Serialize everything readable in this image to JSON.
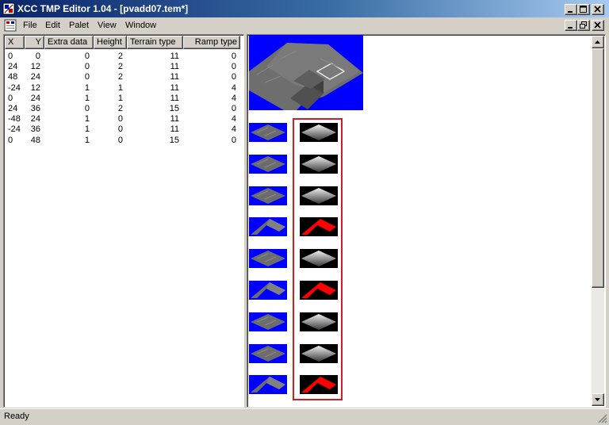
{
  "window": {
    "title": "XCC TMP Editor 1.04 - [pvadd07.tem*]"
  },
  "menu": [
    "File",
    "Edit",
    "Palet",
    "View",
    "Window"
  ],
  "table": {
    "headers": [
      "X",
      "Y",
      "Extra data",
      "Height",
      "Terrain type",
      "Ramp type"
    ],
    "rows": [
      [
        "0",
        "0",
        "0",
        "2",
        "11",
        "0"
      ],
      [
        "24",
        "12",
        "0",
        "2",
        "11",
        "0"
      ],
      [
        "48",
        "24",
        "0",
        "2",
        "11",
        "0"
      ],
      [
        "-24",
        "12",
        "1",
        "1",
        "11",
        "4"
      ],
      [
        "0",
        "24",
        "1",
        "1",
        "11",
        "4"
      ],
      [
        "24",
        "36",
        "0",
        "2",
        "15",
        "0"
      ],
      [
        "-48",
        "24",
        "1",
        "0",
        "11",
        "4"
      ],
      [
        "-24",
        "36",
        "1",
        "0",
        "11",
        "4"
      ],
      [
        "0",
        "48",
        "1",
        "0",
        "15",
        "0"
      ]
    ]
  },
  "tiles": [
    "flat",
    "flat",
    "flat",
    "ramp",
    "flat",
    "ramp",
    "flat",
    "flat",
    "ramp"
  ],
  "colors": {
    "background_blue": "#0000ff",
    "ramp_red": "#ff0000",
    "selection_border": "#cc2020",
    "title_gradient_start": "#0a246a"
  },
  "status": {
    "text": "Ready"
  }
}
